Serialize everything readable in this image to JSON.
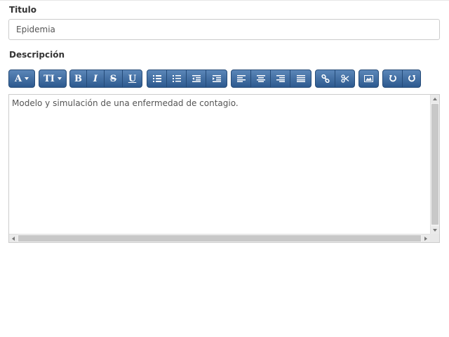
{
  "form": {
    "title_label": "Titulo",
    "title_value": "Epidemia",
    "description_label": "Descripción",
    "description_text": "Modelo y simulación de una enfermedad de contagio."
  },
  "toolbar": {
    "font_label": "A",
    "font_size_label": "TI",
    "bold_label": "B",
    "italic_label": "I",
    "strikethrough_label": "S",
    "underline_label": "U"
  },
  "colors": {
    "button_top": "#5b86b8",
    "button_bottom": "#2d5a8f",
    "button_border": "#254b78"
  },
  "icons": [
    "font-icon",
    "font-size-icon",
    "bold-icon",
    "italic-icon",
    "strikethrough-icon",
    "underline-icon",
    "bulleted-list-icon",
    "numbered-list-icon",
    "outdent-icon",
    "indent-icon",
    "align-left-icon",
    "align-center-icon",
    "align-right-icon",
    "justify-icon",
    "link-icon",
    "unlink-icon",
    "image-icon",
    "undo-icon",
    "redo-icon"
  ]
}
